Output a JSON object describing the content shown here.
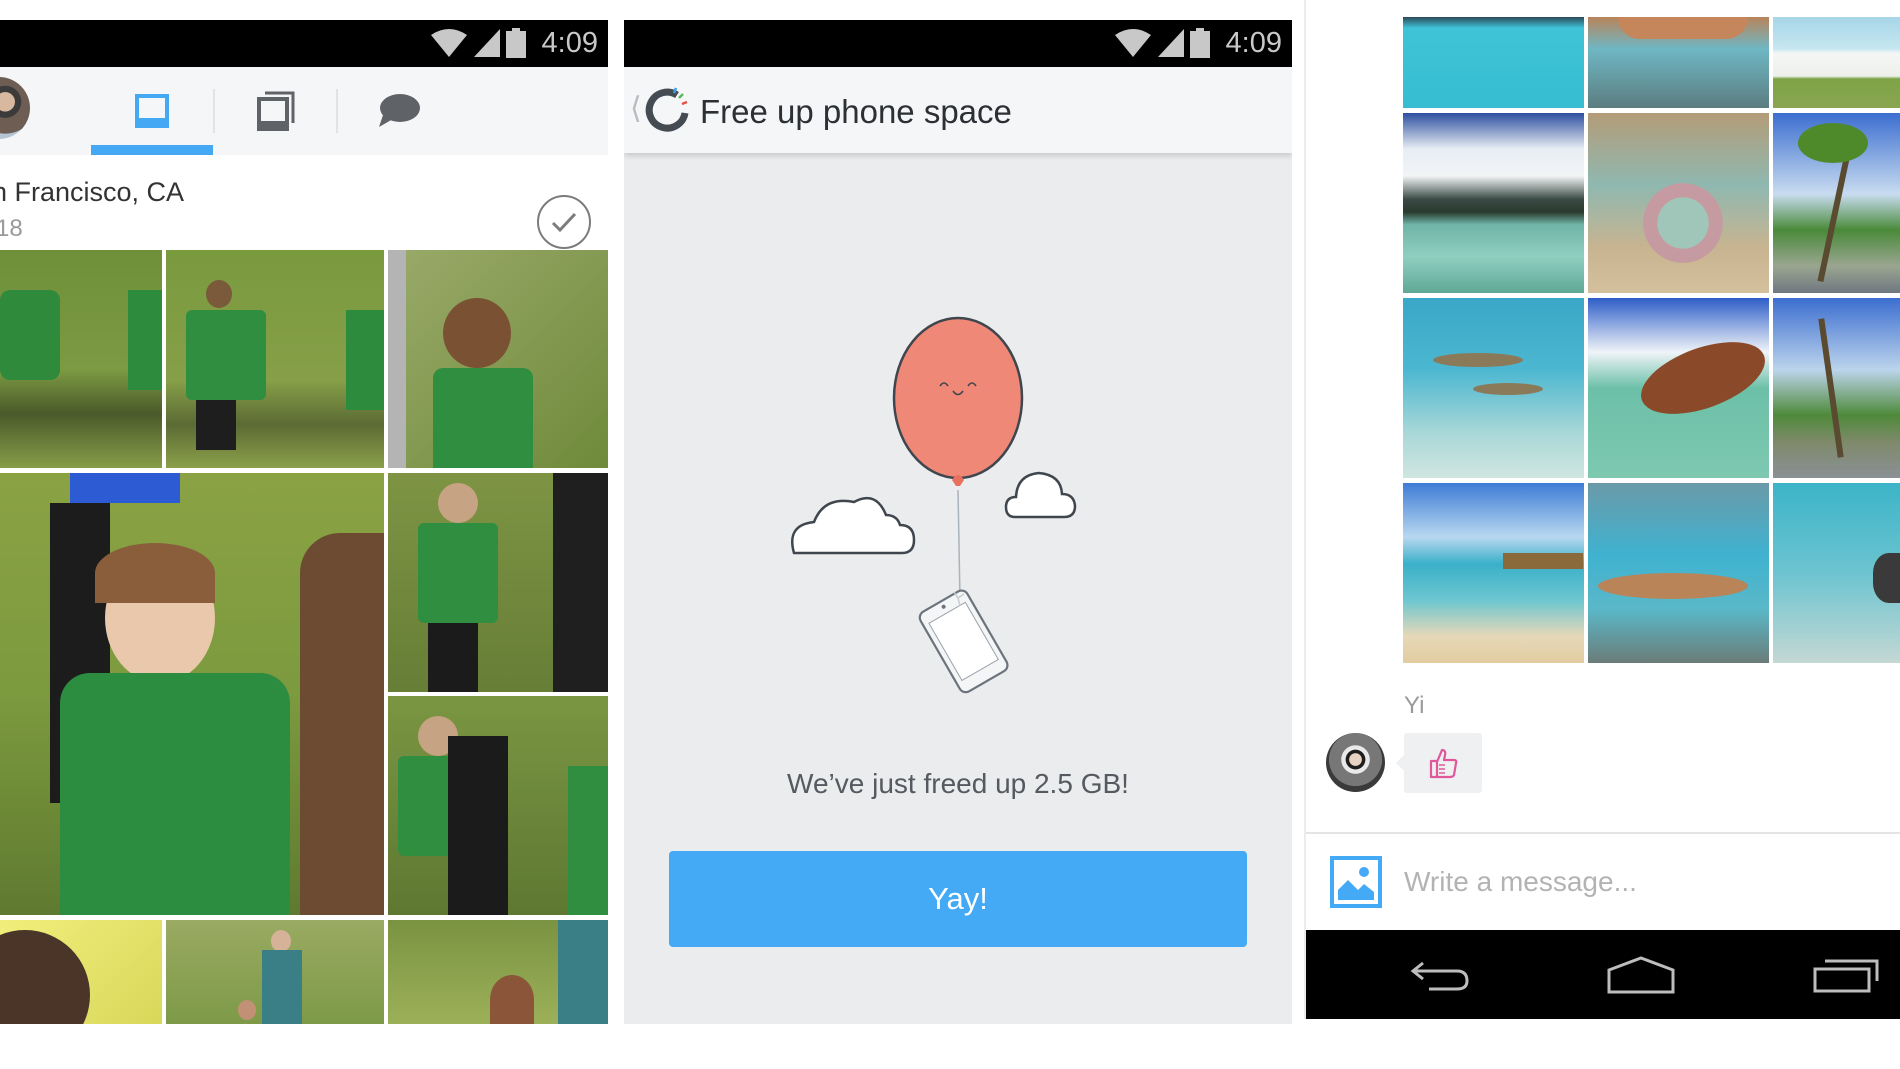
{
  "status_bar": {
    "time": "4:09",
    "icons": [
      "wifi-icon",
      "cell-signal-icon",
      "battery-icon"
    ]
  },
  "gallery_screen": {
    "tabs": [
      {
        "name": "photos",
        "icon": "photo-icon",
        "active": true
      },
      {
        "name": "albums",
        "icon": "albums-icon",
        "active": false
      },
      {
        "name": "conversations",
        "icon": "chat-bubble-icon",
        "active": false
      }
    ],
    "location_title": "n Francisco, CA",
    "date_label": "18",
    "select_icon": "check-circle-icon",
    "photos": [
      {
        "label": "soccer-kid-kicking"
      },
      {
        "label": "soccer-kid-running"
      },
      {
        "label": "soccer-kid-cheering-at-goal"
      },
      {
        "label": "soccer-kids-high-five"
      },
      {
        "label": "soccer-kid-arms-up"
      },
      {
        "label": "soccer-kid-celebrating"
      },
      {
        "label": "kid-closeup"
      },
      {
        "label": "man-in-field"
      },
      {
        "label": "kid-with-adult"
      }
    ]
  },
  "free_space_screen": {
    "title": "Free up phone space",
    "message": "We’ve just freed up 2.5 GB!",
    "button_label": "Yay!",
    "accent_color": "#45aaf5",
    "balloon_color": "#f08878"
  },
  "chat_screen": {
    "photos": [
      {
        "label": "lagoon-water"
      },
      {
        "label": "shark-underwater"
      },
      {
        "label": "white-beach"
      },
      {
        "label": "island-mountains"
      },
      {
        "label": "parrotfish"
      },
      {
        "label": "palm-trees"
      },
      {
        "label": "sharks-in-shallows"
      },
      {
        "label": "shark-close-up"
      },
      {
        "label": "palm-road"
      },
      {
        "label": "overwater-bungalows"
      },
      {
        "label": "shark-near-rocks"
      },
      {
        "label": "sandy-seabed"
      }
    ],
    "sender_name": "Yi",
    "message_sticker": "thumbs-up-icon",
    "input_placeholder": "Write a message...",
    "accent_color": "#45aaf5"
  },
  "nav_bar": {
    "buttons": [
      "back",
      "home",
      "recents"
    ]
  }
}
